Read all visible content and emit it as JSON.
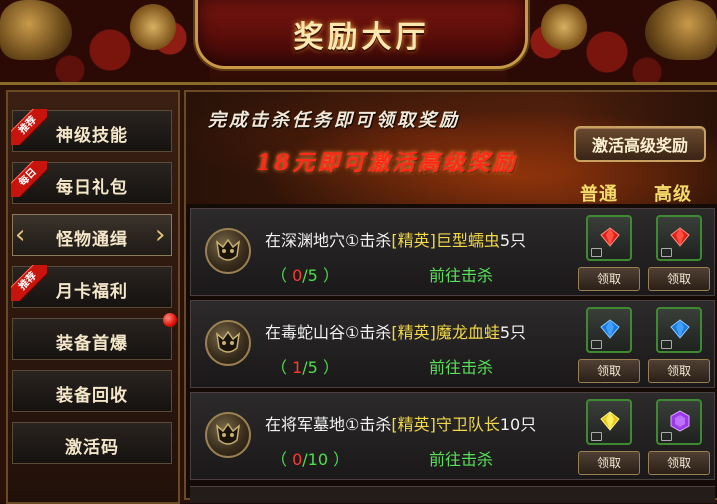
{
  "header": {
    "title": "奖励大厅"
  },
  "sidebar": {
    "items": [
      {
        "label": "神级技能",
        "badge": "推荐",
        "active": false
      },
      {
        "label": "每日礼包",
        "badge": "每日",
        "active": false
      },
      {
        "label": "怪物通缉",
        "badge": "",
        "active": true
      },
      {
        "label": "月卡福利",
        "badge": "推荐",
        "active": false
      },
      {
        "label": "装备首爆",
        "badge": "",
        "active": false,
        "dot": true
      },
      {
        "label": "装备回收",
        "badge": "",
        "active": false
      },
      {
        "label": "激活码",
        "badge": "",
        "active": false
      }
    ]
  },
  "banner": {
    "line1": "完成击杀任务即可领取奖励",
    "line2": "18元即可激活高级奖励",
    "activate_button": "激活高级奖励",
    "col_normal": "普通",
    "col_high": "高级"
  },
  "tasks": [
    {
      "pre": "在深渊地穴①击杀",
      "tag": "[精英]",
      "target": "巨型蠕虫",
      "count": "5只",
      "progress_open": "（ ",
      "progress_cur": "0",
      "progress_rest": "/5 ）",
      "goto": "前往击杀",
      "normal_gem": "red-gem-icon",
      "high_gem": "red-gem-icon",
      "claim_normal": "领取",
      "claim_high": "领取"
    },
    {
      "pre": "在毒蛇山谷①击杀",
      "tag": "[精英]",
      "target": "魔龙血蛙",
      "count": "5只",
      "progress_open": "（ ",
      "progress_cur": "1",
      "progress_rest": "/5 ）",
      "goto": "前往击杀",
      "normal_gem": "blue-gem-icon",
      "high_gem": "blue-gem-icon",
      "claim_normal": "领取",
      "claim_high": "领取"
    },
    {
      "pre": "在将军墓地①击杀",
      "tag": "[精英]",
      "target": "守卫队长",
      "count": "10只",
      "progress_open": "（ ",
      "progress_cur": "0",
      "progress_rest": "/10 ）",
      "goto": "前往击杀",
      "normal_gem": "yellow-gem-icon",
      "high_gem": "purple-gem-icon",
      "claim_normal": "领取",
      "claim_high": "领取"
    }
  ],
  "colors": {
    "red_gem": "#e0201a",
    "blue_gem": "#1a7ae0",
    "yellow_gem": "#e8c818",
    "purple_gem": "#9a3ae8"
  }
}
